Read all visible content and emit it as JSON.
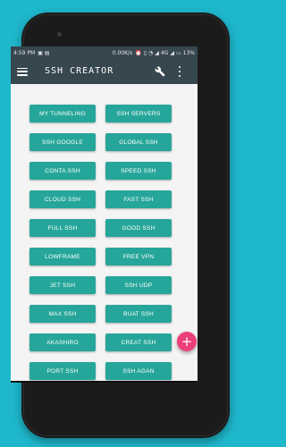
{
  "statusbar": {
    "time": "4:59 PM",
    "speed": "0.00K/s",
    "network": "4G",
    "battery": "13%"
  },
  "toolbar": {
    "title": "SSH CREATOR"
  },
  "buttons": [
    "MY TUNNELING",
    "SSH SERVERS",
    "SSH GOOGLE",
    "GLOBAL SSH",
    "CONTA SSH",
    "SPEED SSH",
    "CLOUD SSH",
    "FAST SSH",
    "FULL SSH",
    "GOOD SSH",
    "LOWFRAME",
    "FREE VPN",
    "JET SSH",
    "SSH UDP",
    "MAX SSH",
    "BUAT SSH",
    "AKASHIRO",
    "CREAT SSH",
    "PORT SSH",
    "SSH AGAN"
  ],
  "fab": {
    "label": "+"
  },
  "colors": {
    "background": "#1fb7cc",
    "toolbar": "#37474f",
    "button": "#26a69a",
    "fab": "#ec407a"
  }
}
